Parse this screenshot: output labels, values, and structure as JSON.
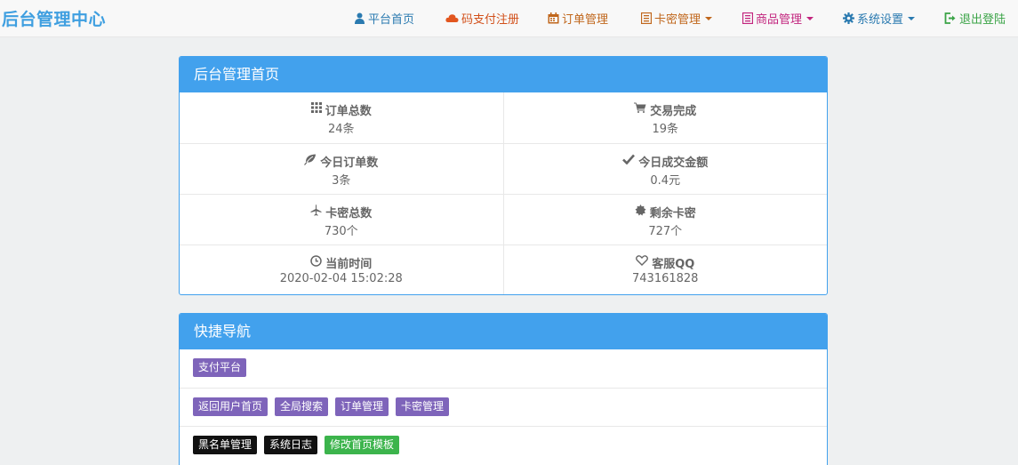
{
  "brand": "后台管理中心",
  "nav": {
    "home": "平台首页",
    "pay_register": "码支付注册",
    "orders": "订单管理",
    "cards": "卡密管理",
    "goods": "商品管理",
    "settings": "系统设置",
    "logout": "退出登陆"
  },
  "colors": {
    "brand": "#3f9fe0",
    "panel_header": "#42a1ed",
    "tag_purple": "#7e64ba",
    "tag_black": "#111111",
    "tag_green": "#3cb44c"
  },
  "dashboard": {
    "title": "后台管理首页",
    "stats": [
      {
        "label": "订单总数",
        "value": "24条",
        "icon": "grid-icon"
      },
      {
        "label": "交易完成",
        "value": "19条",
        "icon": "cart-icon"
      },
      {
        "label": "今日订单数",
        "value": "3条",
        "icon": "leaf-icon"
      },
      {
        "label": "今日成交金额",
        "value": "0.4元",
        "icon": "check-icon"
      },
      {
        "label": "卡密总数",
        "value": "730个",
        "icon": "plane-icon"
      },
      {
        "label": "剩余卡密",
        "value": "727个",
        "icon": "certificate-icon"
      },
      {
        "label": "当前时间",
        "value": "2020-02-04 15:02:28",
        "icon": "clock-icon"
      },
      {
        "label": "客服QQ",
        "value": "743161828",
        "icon": "heart-icon"
      }
    ]
  },
  "quick_nav": {
    "title": "快捷导航",
    "row1": [
      "支付平台"
    ],
    "row2": [
      "返回用户首页",
      "全局搜索",
      "订单管理",
      "卡密管理"
    ],
    "row3": [
      "黑名单管理",
      "系统日志",
      "修改首页模板"
    ]
  }
}
